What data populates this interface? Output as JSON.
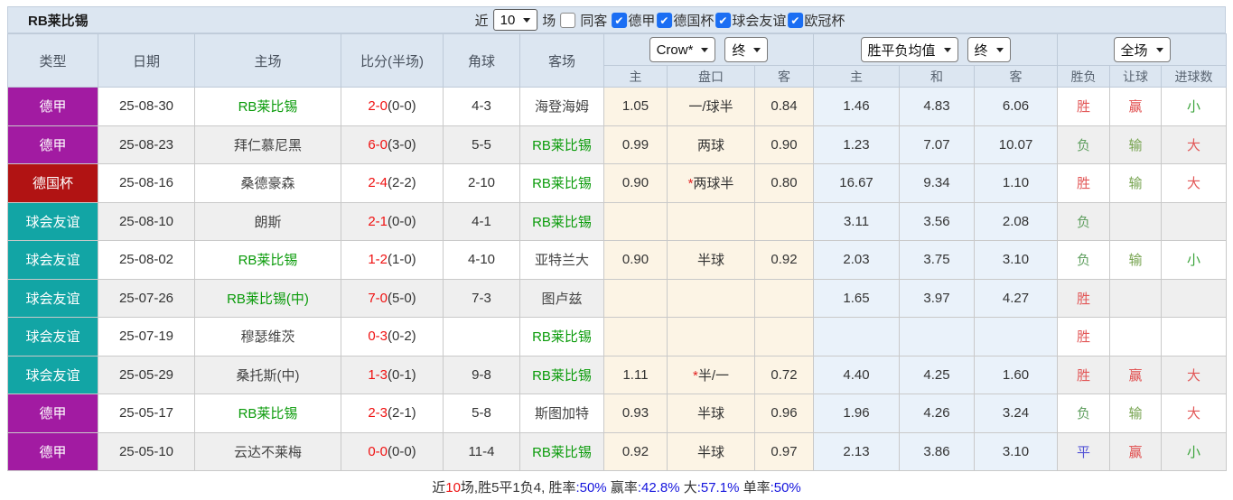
{
  "title": "RB莱比锡",
  "filters": {
    "recent_label": "近",
    "recent_value": "10",
    "matches_label": "场",
    "same_opponent_label": "同客",
    "same_opponent_checked": false,
    "leagues": [
      {
        "label": "德甲",
        "checked": true
      },
      {
        "label": "德国杯",
        "checked": true
      },
      {
        "label": "球会友谊",
        "checked": true
      },
      {
        "label": "欧冠杯",
        "checked": true
      }
    ]
  },
  "header": {
    "type": "类型",
    "date": "日期",
    "home": "主场",
    "score": "比分(半场)",
    "corner": "角球",
    "away": "客场",
    "handicap_select": "Crow*",
    "handicap_state_select": "终",
    "odds_select": "胜平负均值",
    "odds_state_select": "终",
    "fulltime_select": "全场",
    "handicap_cols": [
      "主",
      "盘口",
      "客"
    ],
    "odds_cols": [
      "主",
      "和",
      "客"
    ],
    "result_cols": [
      "胜负",
      "让球",
      "进球数"
    ]
  },
  "rows": [
    {
      "type": "德甲",
      "date": "25-08-30",
      "home": "RB莱比锡",
      "home_self": true,
      "score": "2-0",
      "half": "(0-0)",
      "corner": "4-3",
      "away": "海登海姆",
      "away_self": false,
      "hh": "1.05",
      "handicap": "一/球半",
      "star": false,
      "ha": "0.84",
      "oh": "1.46",
      "od": "4.83",
      "oa": "6.06",
      "res": "胜",
      "let": "赢",
      "goal": "小"
    },
    {
      "type": "德甲",
      "date": "25-08-23",
      "home": "拜仁慕尼黑",
      "home_self": false,
      "score": "6-0",
      "half": "(3-0)",
      "corner": "5-5",
      "away": "RB莱比锡",
      "away_self": true,
      "hh": "0.99",
      "handicap": "两球",
      "star": false,
      "ha": "0.90",
      "oh": "1.23",
      "od": "7.07",
      "oa": "10.07",
      "res": "负",
      "let": "输",
      "goal": "大"
    },
    {
      "type": "德国杯",
      "date": "25-08-16",
      "home": "桑德豪森",
      "home_self": false,
      "score": "2-4",
      "half": "(2-2)",
      "corner": "2-10",
      "away": "RB莱比锡",
      "away_self": true,
      "hh": "0.90",
      "handicap": "两球半",
      "star": true,
      "ha": "0.80",
      "oh": "16.67",
      "od": "9.34",
      "oa": "1.10",
      "res": "胜",
      "let": "输",
      "goal": "大"
    },
    {
      "type": "球会友谊",
      "date": "25-08-10",
      "home": "朗斯",
      "home_self": false,
      "score": "2-1",
      "half": "(0-0)",
      "corner": "4-1",
      "away": "RB莱比锡",
      "away_self": true,
      "hh": "",
      "handicap": "",
      "star": false,
      "ha": "",
      "oh": "3.11",
      "od": "3.56",
      "oa": "2.08",
      "res": "负",
      "let": "",
      "goal": ""
    },
    {
      "type": "球会友谊",
      "date": "25-08-02",
      "home": "RB莱比锡",
      "home_self": true,
      "score": "1-2",
      "half": "(1-0)",
      "corner": "4-10",
      "away": "亚特兰大",
      "away_self": false,
      "hh": "0.90",
      "handicap": "半球",
      "star": false,
      "ha": "0.92",
      "oh": "2.03",
      "od": "3.75",
      "oa": "3.10",
      "res": "负",
      "let": "输",
      "goal": "小"
    },
    {
      "type": "球会友谊",
      "date": "25-07-26",
      "home": "RB莱比锡(中)",
      "home_self": true,
      "score": "7-0",
      "half": "(5-0)",
      "corner": "7-3",
      "away": "图卢兹",
      "away_self": false,
      "hh": "",
      "handicap": "",
      "star": false,
      "ha": "",
      "oh": "1.65",
      "od": "3.97",
      "oa": "4.27",
      "res": "胜",
      "let": "",
      "goal": ""
    },
    {
      "type": "球会友谊",
      "date": "25-07-19",
      "home": "穆瑟维茨",
      "home_self": false,
      "score": "0-3",
      "half": "(0-2)",
      "corner": "",
      "away": "RB莱比锡",
      "away_self": true,
      "hh": "",
      "handicap": "",
      "star": false,
      "ha": "",
      "oh": "",
      "od": "",
      "oa": "",
      "res": "胜",
      "let": "",
      "goal": ""
    },
    {
      "type": "球会友谊",
      "date": "25-05-29",
      "home": "桑托斯(中)",
      "home_self": false,
      "score": "1-3",
      "half": "(0-1)",
      "corner": "9-8",
      "away": "RB莱比锡",
      "away_self": true,
      "hh": "1.11",
      "handicap": "半/一",
      "star": true,
      "ha": "0.72",
      "oh": "4.40",
      "od": "4.25",
      "oa": "1.60",
      "res": "胜",
      "let": "赢",
      "goal": "大"
    },
    {
      "type": "德甲",
      "date": "25-05-17",
      "home": "RB莱比锡",
      "home_self": true,
      "score": "2-3",
      "half": "(2-1)",
      "corner": "5-8",
      "away": "斯图加特",
      "away_self": false,
      "hh": "0.93",
      "handicap": "半球",
      "star": false,
      "ha": "0.96",
      "oh": "1.96",
      "od": "4.26",
      "oa": "3.24",
      "res": "负",
      "let": "输",
      "goal": "大"
    },
    {
      "type": "德甲",
      "date": "25-05-10",
      "home": "云达不莱梅",
      "home_self": false,
      "score": "0-0",
      "half": "(0-0)",
      "corner": "11-4",
      "away": "RB莱比锡",
      "away_self": true,
      "hh": "0.92",
      "handicap": "半球",
      "star": false,
      "ha": "0.97",
      "oh": "2.13",
      "od": "3.86",
      "oa": "3.10",
      "res": "平",
      "let": "赢",
      "goal": "小"
    }
  ],
  "summary": {
    "segments": [
      {
        "text": "近",
        "color": "dark"
      },
      {
        "text": "10",
        "color": "red"
      },
      {
        "text": "场,胜5平1负4, 胜率",
        "color": "dark"
      },
      {
        "text": ":50%",
        "color": "blue"
      },
      {
        "text": " 赢率",
        "color": "dark"
      },
      {
        "text": ":42.8%",
        "color": "blue"
      },
      {
        "text": " 大",
        "color": "dark"
      },
      {
        "text": ":57.1%",
        "color": "blue"
      },
      {
        "text": " 单率",
        "color": "dark"
      },
      {
        "text": ":50%",
        "color": "blue"
      }
    ]
  },
  "colors": {
    "league": {
      "德甲": "#a21ba2",
      "德国杯": "#b11313",
      "球会友谊": "#12a5a5"
    },
    "outcome": {
      "胜": "#e25757",
      "负": "#61a061",
      "平": "#5454d6",
      "赢": "#e04b4b",
      "输": "#76a34f",
      "大": "#e25757",
      "小": "#3ca43c"
    },
    "self_team": "#0a9b0a",
    "score_red": "#ef1111",
    "summary": {
      "dark": "#333333",
      "red": "#ee1111",
      "blue": "#1414dd"
    }
  }
}
